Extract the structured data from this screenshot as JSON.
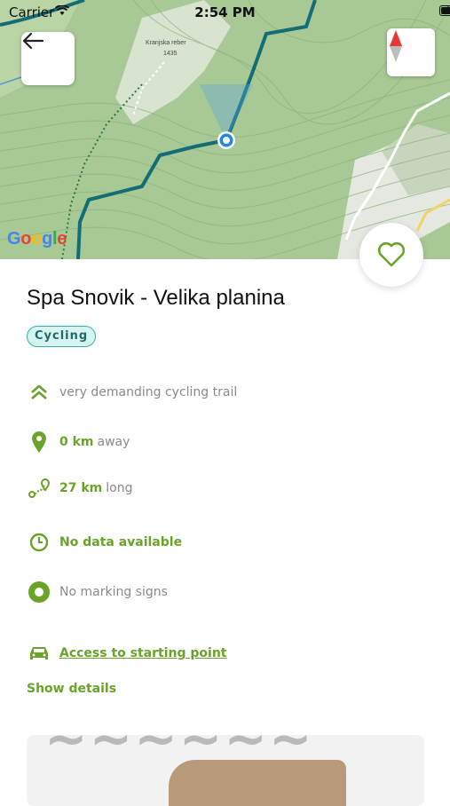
{
  "status_bar": {
    "carrier": "Carrier",
    "time": "2:54 PM"
  },
  "map": {
    "peak_label": "Kranjska reber",
    "elevation_label": "1435",
    "provider": "Google"
  },
  "trail": {
    "title": "Spa Snovik - Velika planina",
    "category": "Cycling",
    "difficulty": "very demanding cycling trail",
    "distance_value": "0 km",
    "distance_suffix": "away",
    "length_value": "27 km",
    "length_suffix": "long",
    "duration": "No data available",
    "marking": "No marking signs",
    "access_link": "Access to starting point",
    "show_details": "Show details"
  },
  "colors": {
    "accent": "#6aa329",
    "route": "#136d75",
    "badge_bg": "#d6f4f1",
    "badge_border": "#34b3a8"
  }
}
